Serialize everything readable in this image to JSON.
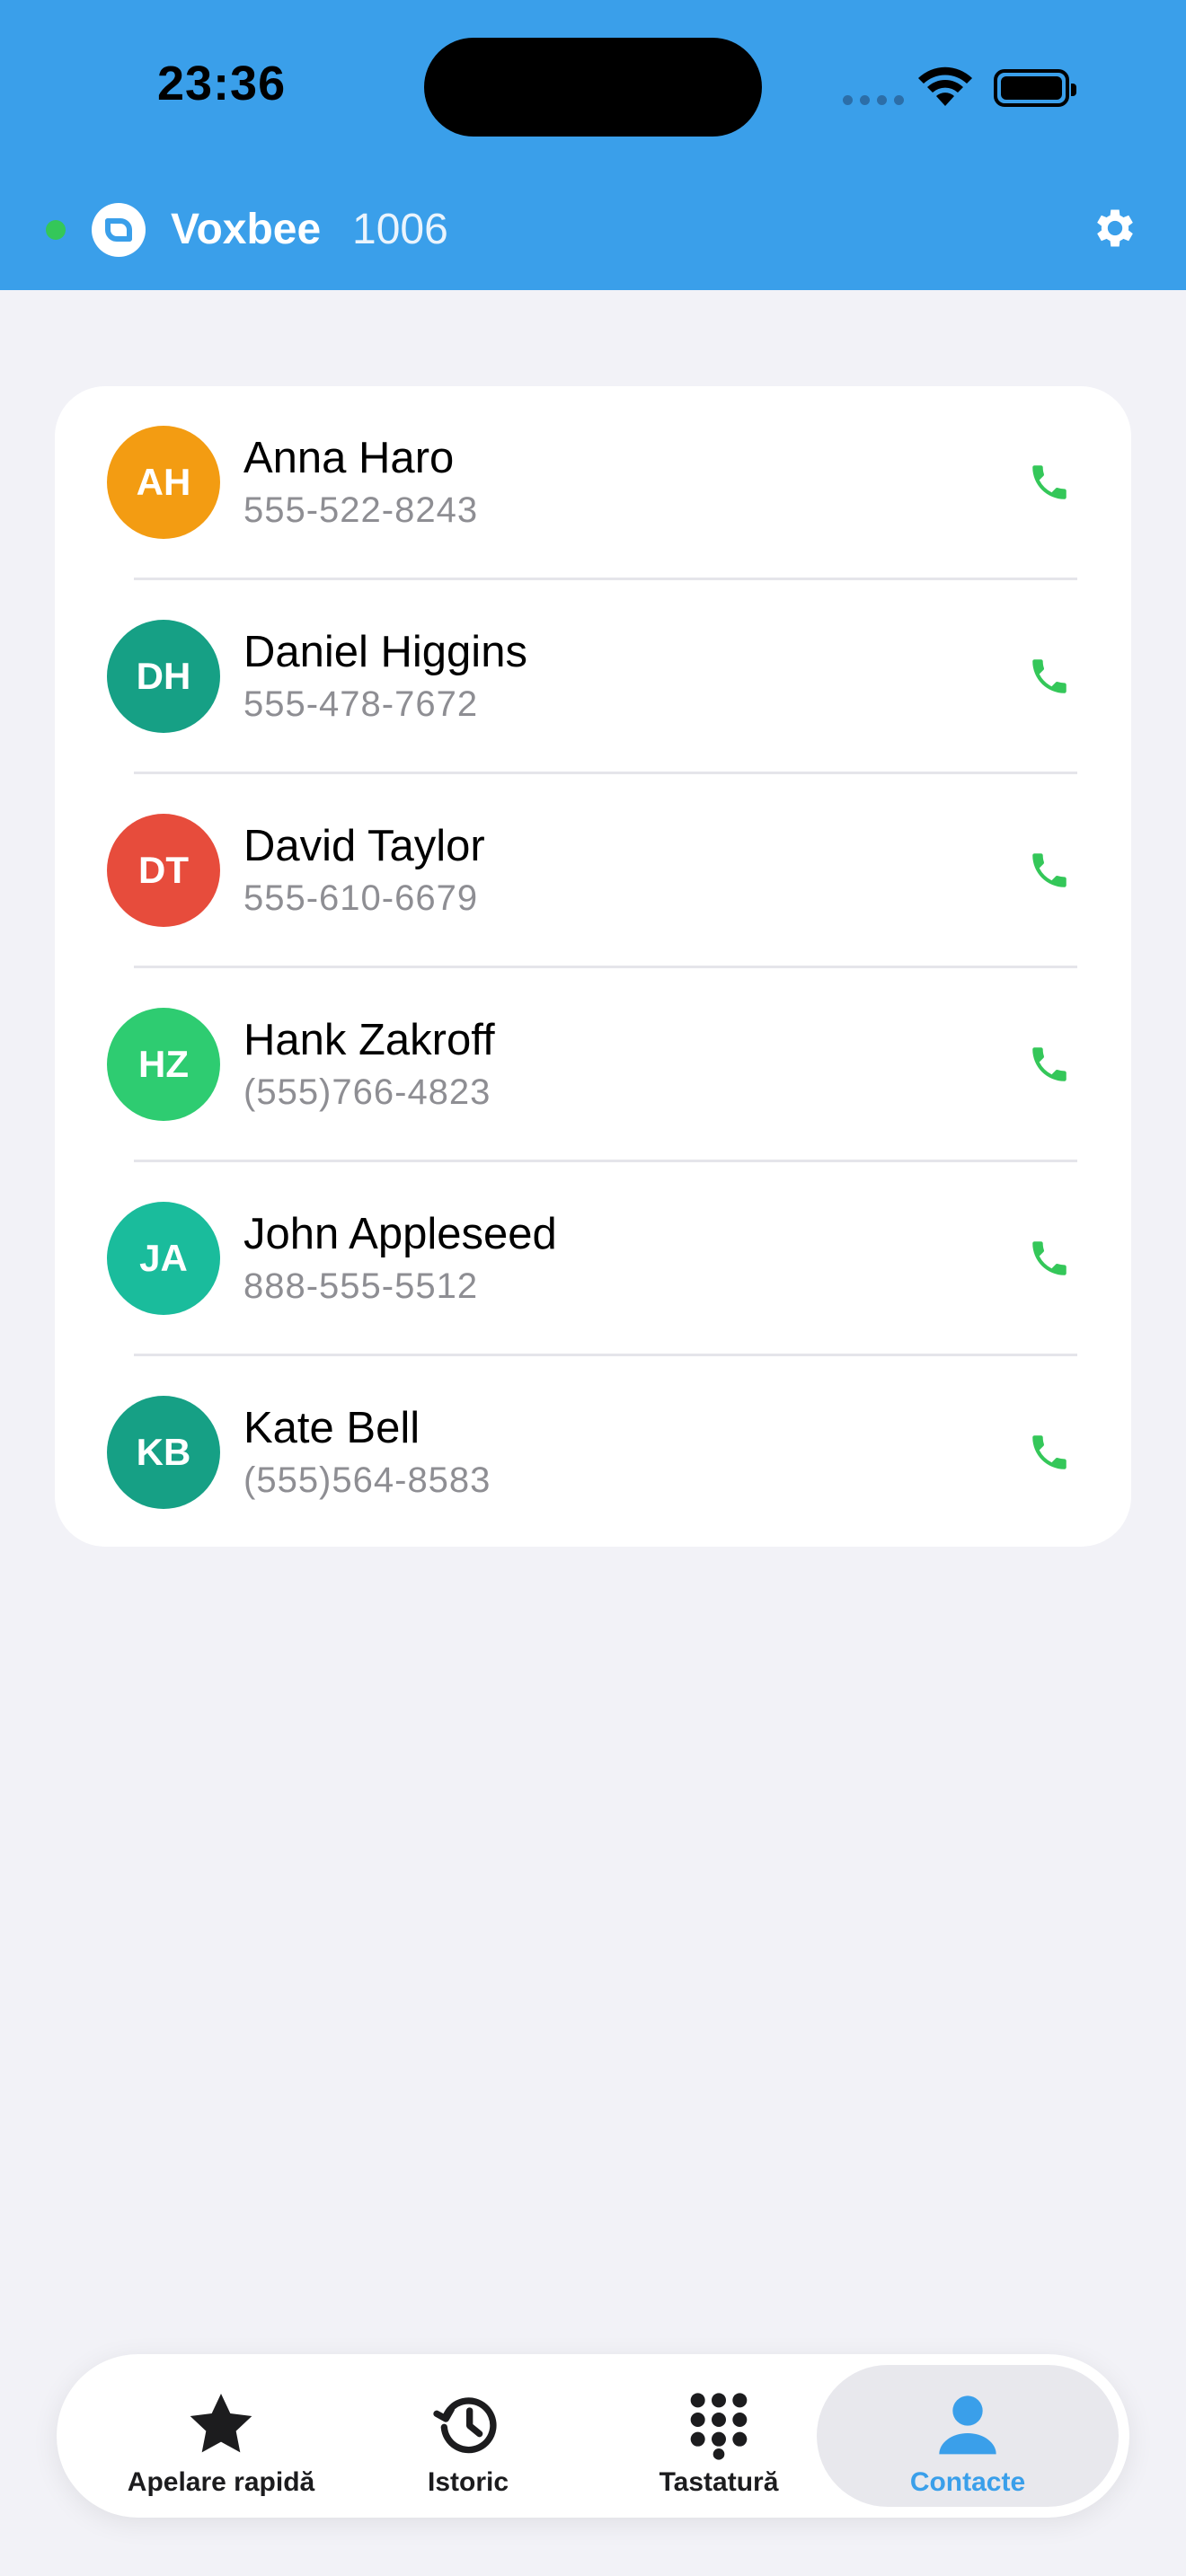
{
  "status_bar": {
    "time": "23:36"
  },
  "header": {
    "app_name": "Voxbee",
    "extension": "1006"
  },
  "contacts": [
    {
      "initials": "AH",
      "name": "Anna Haro",
      "phone": "555-522-8243",
      "color": "#f39c12"
    },
    {
      "initials": "DH",
      "name": "Daniel Higgins",
      "phone": "555-478-7672",
      "color": "#16a085"
    },
    {
      "initials": "DT",
      "name": "David Taylor",
      "phone": "555-610-6679",
      "color": "#e74c3c"
    },
    {
      "initials": "HZ",
      "name": "Hank Zakroff",
      "phone": "(555)766-4823",
      "color": "#2ecc71"
    },
    {
      "initials": "JA",
      "name": "John Appleseed",
      "phone": "888-555-5512",
      "color": "#1abc9c"
    },
    {
      "initials": "KB",
      "name": "Kate Bell",
      "phone": "(555)564-8583",
      "color": "#16a085"
    }
  ],
  "tabs": [
    {
      "label": "Apelare rapidă",
      "icon": "star-icon",
      "active": false
    },
    {
      "label": "Istoric",
      "icon": "history-icon",
      "active": false
    },
    {
      "label": "Tastatură",
      "icon": "keypad-icon",
      "active": false
    },
    {
      "label": "Contacte",
      "icon": "person-icon",
      "active": true
    }
  ],
  "colors": {
    "header": "#3a9fea",
    "accent": "#3a9fea",
    "call_green": "#34c759",
    "background": "#f2f2f7"
  }
}
